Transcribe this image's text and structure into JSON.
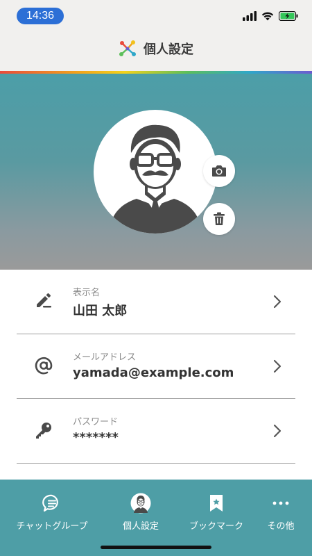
{
  "status_bar": {
    "time": "14:36"
  },
  "header": {
    "title": "個人設定",
    "logo_icon": "app-logo-icon"
  },
  "profile": {
    "avatar_icon": "avatar-man-icon",
    "camera_icon": "camera-icon",
    "trash_icon": "trash-icon"
  },
  "settings": {
    "items": [
      {
        "caption": "表示名",
        "value": "山田 太郎",
        "icon": "pencil-icon"
      },
      {
        "caption": "メールアドレス",
        "value": "yamada@example.com",
        "icon": "at-icon"
      },
      {
        "caption": "パスワード",
        "value": "*******",
        "icon": "key-icon"
      }
    ]
  },
  "tab_bar": {
    "tabs": [
      {
        "label": "チャットグループ",
        "icon": "chat-icon"
      },
      {
        "label": "個人設定",
        "icon": "avatar-icon",
        "active": true
      },
      {
        "label": "ブックマーク",
        "icon": "bookmark-icon"
      },
      {
        "label": "その他",
        "icon": "more-icon"
      }
    ]
  },
  "colors": {
    "accent": "#4e9ea6",
    "time_pill": "#2c6fd6",
    "battery": "#34c759"
  }
}
